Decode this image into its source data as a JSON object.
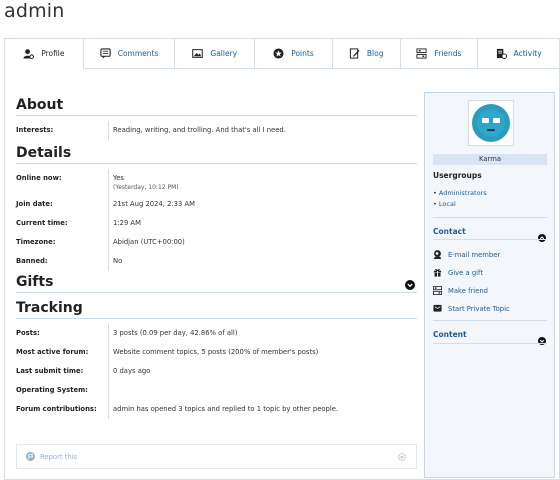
{
  "page": {
    "title": "admin"
  },
  "tabs": [
    {
      "label": "Profile",
      "icon": "user-icon",
      "active": true
    },
    {
      "label": "Comments",
      "icon": "comments-icon"
    },
    {
      "label": "Gallery",
      "icon": "gallery-icon"
    },
    {
      "label": "Points",
      "icon": "points-icon"
    },
    {
      "label": "Blog",
      "icon": "blog-icon"
    },
    {
      "label": "Friends",
      "icon": "friends-icon"
    },
    {
      "label": "Activity",
      "icon": "activity-icon"
    }
  ],
  "about": {
    "heading": "About",
    "interests_label": "Interests:",
    "interests_value": "Reading, writing, and trolling. And that's all I need."
  },
  "details": {
    "heading": "Details",
    "online_label": "Online now:",
    "online_value": "Yes",
    "online_sub": "(Yesterday, 10:12 PM)",
    "join_label": "Join date:",
    "join_value": "21st Aug 2024, 2:33 AM",
    "time_label": "Current time:",
    "time_value": "1:29 AM",
    "tz_label": "Timezone:",
    "tz_value": "Abidjan (UTC+00:00)",
    "banned_label": "Banned:",
    "banned_value": "No"
  },
  "gifts": {
    "heading": "Gifts"
  },
  "tracking": {
    "heading": "Tracking",
    "posts_label": "Posts:",
    "posts_value": "3 posts (0.09 per day, 42.86% of all)",
    "forum_label": "Most active forum:",
    "forum_value": "Website comment topics, 5 posts (200% of member's posts)",
    "submit_label": "Last submit time:",
    "submit_value": "0 days ago",
    "os_label": "Operating System:",
    "os_value": "",
    "contrib_label": "Forum contributions:",
    "contrib_value": "admin has opened 3 topics and replied to 1 topic by other people."
  },
  "report": {
    "label": "Report this"
  },
  "sidebar": {
    "karma": "Karma",
    "usergroups_heading": "Usergroups",
    "usergroups": [
      "Administrators",
      "Local"
    ],
    "contact_heading": "Contact",
    "contact_items": [
      {
        "label": "E-mail member",
        "icon": "email-icon"
      },
      {
        "label": "Give a gift",
        "icon": "gift-icon"
      },
      {
        "label": "Make friend",
        "icon": "friends-icon"
      },
      {
        "label": "Start Private Topic",
        "icon": "private-topic-icon"
      }
    ],
    "content_heading": "Content"
  },
  "colors": {
    "link": "#1d5c98",
    "avatar": "#2a9dbd",
    "sidebar_bg": "#f3f7fb"
  }
}
